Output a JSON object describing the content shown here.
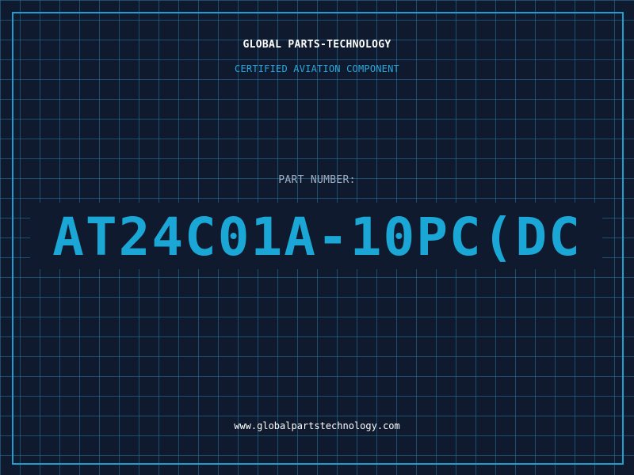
{
  "header": {
    "company": "GLOBAL PARTS-TECHNOLOGY",
    "subtitle": "CERTIFIED AVIATION COMPONENT"
  },
  "part": {
    "label": "PART NUMBER:",
    "value": "AT24C01A-10PC(DC"
  },
  "footer": {
    "url": "www.globalpartstechnology.com"
  },
  "colors": {
    "background": "#0f1a2e",
    "grid": "#28789f",
    "accent": "#1aa7d6",
    "text": "#ffffff",
    "muted": "#9fb0c4"
  }
}
